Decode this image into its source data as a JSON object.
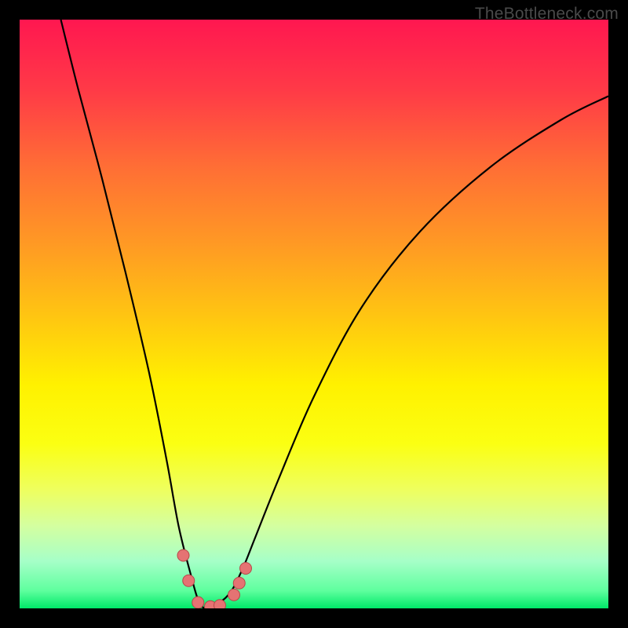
{
  "watermark": "TheBottleneck.com",
  "chart_data": {
    "type": "line",
    "title": "",
    "xlabel": "",
    "ylabel": "",
    "xlim": [
      0,
      100
    ],
    "ylim": [
      0,
      100
    ],
    "series": [
      {
        "name": "bottleneck-curve",
        "x": [
          7,
          10,
          14,
          18,
          22,
          25,
          27,
          29,
          30.5,
          32,
          34,
          36,
          38,
          40,
          44,
          50,
          58,
          68,
          80,
          92,
          100
        ],
        "values": [
          100,
          88,
          73,
          57,
          40,
          25,
          14,
          6,
          1,
          0,
          1,
          3,
          7,
          12,
          22,
          36,
          51,
          64,
          75,
          83,
          87
        ]
      }
    ],
    "markers": [
      {
        "name": "point-a",
        "x": 27.8,
        "y": 9
      },
      {
        "name": "point-b",
        "x": 28.7,
        "y": 4.7
      },
      {
        "name": "point-c",
        "x": 30.3,
        "y": 1
      },
      {
        "name": "point-d",
        "x": 32.4,
        "y": 0.3
      },
      {
        "name": "point-e",
        "x": 34,
        "y": 0.5
      },
      {
        "name": "point-f",
        "x": 36.4,
        "y": 2.3
      },
      {
        "name": "point-g",
        "x": 37.3,
        "y": 4.3
      },
      {
        "name": "point-h",
        "x": 38.4,
        "y": 6.8
      }
    ],
    "marker_color": "#e57373",
    "marker_stroke": "#b54848",
    "curve_color": "#000000"
  }
}
